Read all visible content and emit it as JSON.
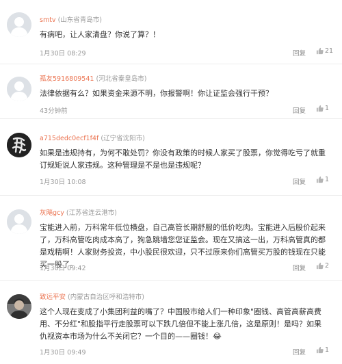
{
  "colors": {
    "username": "#eb7350",
    "meta": "#999999",
    "text": "#333333"
  },
  "comments": [
    {
      "username": "smtv",
      "location": "(山东省青岛市)",
      "text": "有病吧，让人家清盘？你说了算？！",
      "time": "1月30日 08:29",
      "reply": "回复",
      "likes": "21",
      "avatar_icon": "default-avatar-icon"
    },
    {
      "username": "孤友5916809541",
      "location": "(河北省秦皇岛市)",
      "text": "法律依据有么？如果资金来源不明，你报警啊！你让证监会强行干预？",
      "time": "43分钟前",
      "reply": "回复",
      "likes": "1",
      "avatar_icon": "default-avatar-icon"
    },
    {
      "username": "a715dedc0ecf1f4f",
      "location": "(辽宁省沈阳市)",
      "text": "如果是违规持有，为何不敢处罚？你没有政策的时候人家买了股票，你觉得吃亏了就重订规矩说人家违规。这种管理是不是也是违规呢？",
      "time": "1月30日 10:08",
      "reply": "回复",
      "likes": "1",
      "avatar_icon": "calligraphy-avatar-icon"
    },
    {
      "username": "灰飚gcy",
      "location": "(江苏省连云港市)",
      "text": "宝能进入前，万科常年低位横盘，自己高管长期舒服的低价吃肉。宝能进入后股价起来了，万科高管吃肉成本高了，狗急跳墙您您证监会。现在又搞这一出，万科高管真的都是戏精啊！人家财务投资，中小股民很欢迎，只不过原来你们高管买万股的钱现在只能买一股了。",
      "time": "1月30日 09:42",
      "reply": "回复",
      "likes": "2",
      "avatar_icon": "default-avatar-icon"
    },
    {
      "username": "致远平安",
      "location": "(内蒙古自治区呼和浩特市)",
      "text": "这个人现在变成了小集团利益的嘴了？中国股市给人们一种印象\"圈钱、高管高薪高费用、不分红\"和股指平行走股票可以下跌几倍但不能上涨几倍，这是原则！是吗？如果仇视资本市场为什么不关闭它？一个目的——圈钱！😂",
      "time": "1月30日 09:49",
      "reply": "回复",
      "likes": "1",
      "avatar_icon": "photo-avatar-icon"
    }
  ]
}
